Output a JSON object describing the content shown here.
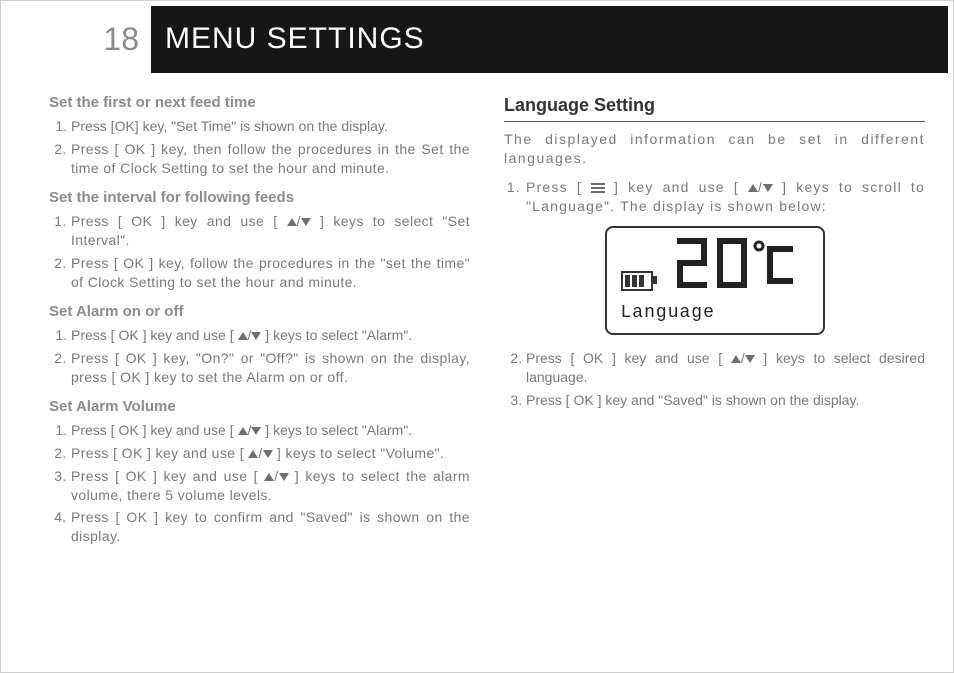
{
  "page_number": "18",
  "page_title": "MENU SETTINGS",
  "left": {
    "s1": {
      "h": "Set the first or next feed time",
      "i1": "Press [OK] key, \"Set Time\" is shown on the display.",
      "i2": "Press [ OK ] key, then follow the procedures in the Set the time of Clock Setting to set the hour and minute."
    },
    "s2": {
      "h": "Set the interval for following feeds",
      "i1a": "Press [ OK ] key and use [ ",
      "i1b": " ] keys to select \"Set Interval\".",
      "i2": "Press [ OK ] key, follow the procedures in the \"set the time\" of Clock Setting to set the hour and minute."
    },
    "s3": {
      "h": "Set Alarm on or off",
      "i1a": "Press [ OK ] key and use [ ",
      "i1b": " ] keys to select \"Alarm\".",
      "i2": "Press [ OK ] key, \"On?\" or \"Off?\" is shown on the display, press [ OK ] key to set the Alarm on or off."
    },
    "s4": {
      "h": "Set Alarm Volume",
      "i1a": "Press [ OK ] key and use [ ",
      "i1b": " ] keys to select \"Alarm\".",
      "i2a": "Press [ OK ] key and use [ ",
      "i2b": " ] keys to select \"Volume\".",
      "i3a": "Press [ OK ] key and use [ ",
      "i3b": " ] keys to select the alarm volume, there 5 volume levels.",
      "i4": "Press [ OK ] key to confirm and \"Saved\" is shown on the display."
    }
  },
  "right": {
    "h": "Language Setting",
    "intro": "The displayed information can be set in different languages.",
    "i1a": "Press [ ",
    "i1b": " ] key and use [ ",
    "i1c": " ] keys to scroll to \"Language\". The display is shown below:",
    "lcd_label": "Language",
    "i2a": "Press [ OK ] key and use [ ",
    "i2b": " ] keys to select desired language.",
    "i3": "Press [ OK ] key and \"Saved\" is shown on the display."
  }
}
